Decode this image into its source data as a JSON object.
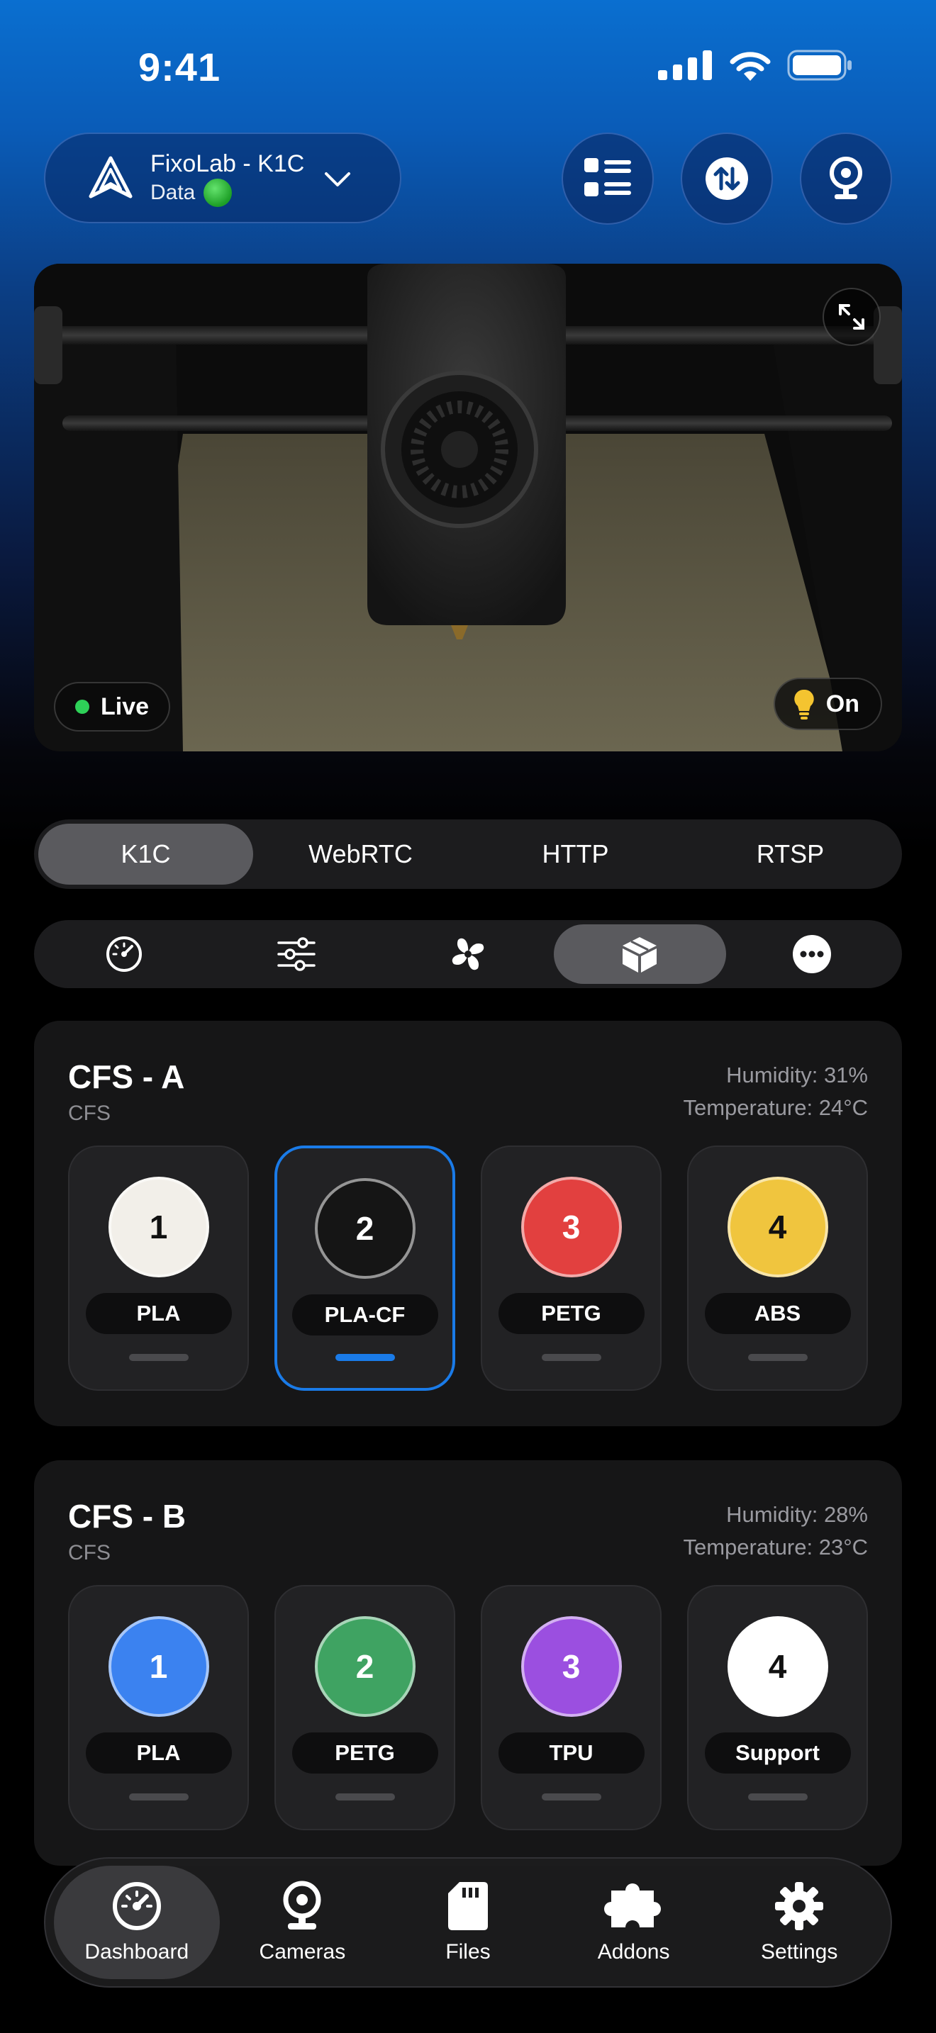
{
  "status_bar": {
    "time": "9:41"
  },
  "header": {
    "printer_name": "FixoLab - K1C",
    "printer_source": "Data",
    "status_color": "#2ecc40"
  },
  "camera": {
    "live_label": "Live",
    "light_label": "On"
  },
  "stream_tabs": [
    {
      "label": "K1C",
      "active": true
    },
    {
      "label": "WebRTC",
      "active": false
    },
    {
      "label": "HTTP",
      "active": false
    },
    {
      "label": "RTSP",
      "active": false
    }
  ],
  "control_tabs": [
    {
      "icon": "gauge-icon",
      "active": false
    },
    {
      "icon": "sliders-icon",
      "active": false
    },
    {
      "icon": "fan-icon",
      "active": false
    },
    {
      "icon": "box-icon",
      "active": true
    },
    {
      "icon": "more-icon",
      "active": false
    }
  ],
  "cfs_units": [
    {
      "title": "CFS - A",
      "subtitle": "CFS",
      "humidity": "Humidity: 31%",
      "temperature": "Temperature: 24°C",
      "slots": [
        {
          "number": "1",
          "material": "PLA",
          "color": "#f2efe9",
          "text_color": "#111111",
          "selected": false
        },
        {
          "number": "2",
          "material": "PLA-CF",
          "color": "#151515",
          "text_color": "#ffffff",
          "selected": true
        },
        {
          "number": "3",
          "material": "PETG",
          "color": "#e2403f",
          "text_color": "#ffffff",
          "selected": false
        },
        {
          "number": "4",
          "material": "ABS",
          "color": "#f0c53e",
          "text_color": "#111111",
          "selected": false
        }
      ]
    },
    {
      "title": "CFS - B",
      "subtitle": "CFS",
      "humidity": "Humidity: 28%",
      "temperature": "Temperature: 23°C",
      "slots": [
        {
          "number": "1",
          "material": "PLA",
          "color": "#3b82f0",
          "text_color": "#ffffff",
          "selected": false
        },
        {
          "number": "2",
          "material": "PETG",
          "color": "#3fa362",
          "text_color": "#ffffff",
          "selected": false
        },
        {
          "number": "3",
          "material": "TPU",
          "color": "#9b4fe0",
          "text_color": "#ffffff",
          "selected": false
        },
        {
          "number": "4",
          "material": "Support",
          "color": "#ffffff",
          "text_color": "#111111",
          "selected": false
        }
      ]
    }
  ],
  "tab_bar": [
    {
      "label": "Dashboard",
      "icon": "gauge-icon",
      "active": true
    },
    {
      "label": "Cameras",
      "icon": "webcam-icon",
      "active": false
    },
    {
      "label": "Files",
      "icon": "sd-card-icon",
      "active": false
    },
    {
      "label": "Addons",
      "icon": "puzzle-icon",
      "active": false
    },
    {
      "label": "Settings",
      "icon": "gear-icon",
      "active": false
    }
  ]
}
